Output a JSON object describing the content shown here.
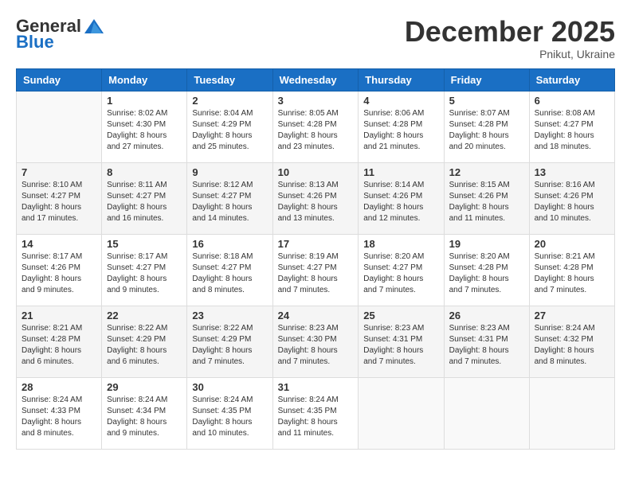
{
  "header": {
    "logo_general": "General",
    "logo_blue": "Blue",
    "month_year": "December 2025",
    "location": "Pnikut, Ukraine"
  },
  "days_of_week": [
    "Sunday",
    "Monday",
    "Tuesday",
    "Wednesday",
    "Thursday",
    "Friday",
    "Saturday"
  ],
  "weeks": [
    [
      {
        "day": "",
        "info": ""
      },
      {
        "day": "1",
        "info": "Sunrise: 8:02 AM\nSunset: 4:30 PM\nDaylight: 8 hours\nand 27 minutes."
      },
      {
        "day": "2",
        "info": "Sunrise: 8:04 AM\nSunset: 4:29 PM\nDaylight: 8 hours\nand 25 minutes."
      },
      {
        "day": "3",
        "info": "Sunrise: 8:05 AM\nSunset: 4:28 PM\nDaylight: 8 hours\nand 23 minutes."
      },
      {
        "day": "4",
        "info": "Sunrise: 8:06 AM\nSunset: 4:28 PM\nDaylight: 8 hours\nand 21 minutes."
      },
      {
        "day": "5",
        "info": "Sunrise: 8:07 AM\nSunset: 4:28 PM\nDaylight: 8 hours\nand 20 minutes."
      },
      {
        "day": "6",
        "info": "Sunrise: 8:08 AM\nSunset: 4:27 PM\nDaylight: 8 hours\nand 18 minutes."
      }
    ],
    [
      {
        "day": "7",
        "info": "Sunrise: 8:10 AM\nSunset: 4:27 PM\nDaylight: 8 hours\nand 17 minutes."
      },
      {
        "day": "8",
        "info": "Sunrise: 8:11 AM\nSunset: 4:27 PM\nDaylight: 8 hours\nand 16 minutes."
      },
      {
        "day": "9",
        "info": "Sunrise: 8:12 AM\nSunset: 4:27 PM\nDaylight: 8 hours\nand 14 minutes."
      },
      {
        "day": "10",
        "info": "Sunrise: 8:13 AM\nSunset: 4:26 PM\nDaylight: 8 hours\nand 13 minutes."
      },
      {
        "day": "11",
        "info": "Sunrise: 8:14 AM\nSunset: 4:26 PM\nDaylight: 8 hours\nand 12 minutes."
      },
      {
        "day": "12",
        "info": "Sunrise: 8:15 AM\nSunset: 4:26 PM\nDaylight: 8 hours\nand 11 minutes."
      },
      {
        "day": "13",
        "info": "Sunrise: 8:16 AM\nSunset: 4:26 PM\nDaylight: 8 hours\nand 10 minutes."
      }
    ],
    [
      {
        "day": "14",
        "info": "Sunrise: 8:17 AM\nSunset: 4:26 PM\nDaylight: 8 hours\nand 9 minutes."
      },
      {
        "day": "15",
        "info": "Sunrise: 8:17 AM\nSunset: 4:27 PM\nDaylight: 8 hours\nand 9 minutes."
      },
      {
        "day": "16",
        "info": "Sunrise: 8:18 AM\nSunset: 4:27 PM\nDaylight: 8 hours\nand 8 minutes."
      },
      {
        "day": "17",
        "info": "Sunrise: 8:19 AM\nSunset: 4:27 PM\nDaylight: 8 hours\nand 7 minutes."
      },
      {
        "day": "18",
        "info": "Sunrise: 8:20 AM\nSunset: 4:27 PM\nDaylight: 8 hours\nand 7 minutes."
      },
      {
        "day": "19",
        "info": "Sunrise: 8:20 AM\nSunset: 4:28 PM\nDaylight: 8 hours\nand 7 minutes."
      },
      {
        "day": "20",
        "info": "Sunrise: 8:21 AM\nSunset: 4:28 PM\nDaylight: 8 hours\nand 7 minutes."
      }
    ],
    [
      {
        "day": "21",
        "info": "Sunrise: 8:21 AM\nSunset: 4:28 PM\nDaylight: 8 hours\nand 6 minutes."
      },
      {
        "day": "22",
        "info": "Sunrise: 8:22 AM\nSunset: 4:29 PM\nDaylight: 8 hours\nand 6 minutes."
      },
      {
        "day": "23",
        "info": "Sunrise: 8:22 AM\nSunset: 4:29 PM\nDaylight: 8 hours\nand 7 minutes."
      },
      {
        "day": "24",
        "info": "Sunrise: 8:23 AM\nSunset: 4:30 PM\nDaylight: 8 hours\nand 7 minutes."
      },
      {
        "day": "25",
        "info": "Sunrise: 8:23 AM\nSunset: 4:31 PM\nDaylight: 8 hours\nand 7 minutes."
      },
      {
        "day": "26",
        "info": "Sunrise: 8:23 AM\nSunset: 4:31 PM\nDaylight: 8 hours\nand 7 minutes."
      },
      {
        "day": "27",
        "info": "Sunrise: 8:24 AM\nSunset: 4:32 PM\nDaylight: 8 hours\nand 8 minutes."
      }
    ],
    [
      {
        "day": "28",
        "info": "Sunrise: 8:24 AM\nSunset: 4:33 PM\nDaylight: 8 hours\nand 8 minutes."
      },
      {
        "day": "29",
        "info": "Sunrise: 8:24 AM\nSunset: 4:34 PM\nDaylight: 8 hours\nand 9 minutes."
      },
      {
        "day": "30",
        "info": "Sunrise: 8:24 AM\nSunset: 4:35 PM\nDaylight: 8 hours\nand 10 minutes."
      },
      {
        "day": "31",
        "info": "Sunrise: 8:24 AM\nSunset: 4:35 PM\nDaylight: 8 hours\nand 11 minutes."
      },
      {
        "day": "",
        "info": ""
      },
      {
        "day": "",
        "info": ""
      },
      {
        "day": "",
        "info": ""
      }
    ]
  ]
}
